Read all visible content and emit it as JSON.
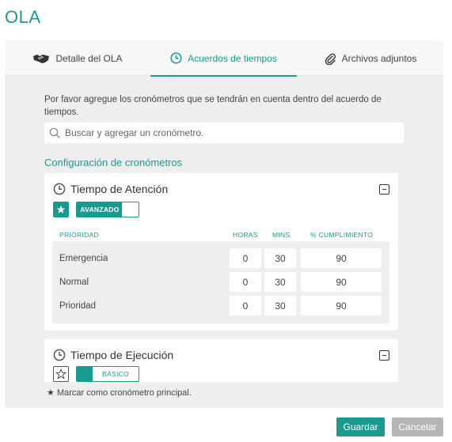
{
  "page": {
    "title": "OLA"
  },
  "tabs": [
    {
      "label": "Detalle del OLA",
      "icon": "handshake-icon",
      "active": false
    },
    {
      "label": "Acuerdos de tiempos",
      "icon": "clock-icon",
      "active": true
    },
    {
      "label": "Archivos adjuntos",
      "icon": "paperclip-icon",
      "active": false
    }
  ],
  "intro": "Por favor agregue los cronómetros que se tendrán en cuenta dentro del acuerdo de tiempos.",
  "search": {
    "placeholder": "Buscar y agregar un cronómetro.",
    "value": "",
    "icon": "search-icon"
  },
  "section_title": "Configuración de cronómetros",
  "timers": [
    {
      "title": "Tiempo de Atención",
      "starred": true,
      "mode_label": "AVANZADO",
      "columns": {
        "priority": "PRIORIDAD",
        "hours": "HORAS",
        "mins": "MINS",
        "compliance": "% CUMPLIMIENTO"
      },
      "rows": [
        {
          "label": "Emergencia",
          "hours": "0",
          "mins": "30",
          "compliance": "90"
        },
        {
          "label": "Normal",
          "hours": "0",
          "mins": "30",
          "compliance": "90"
        },
        {
          "label": "Prioridad",
          "hours": "0",
          "mins": "30",
          "compliance": "90"
        }
      ]
    },
    {
      "title": "Tiempo de Ejecución",
      "starred": false,
      "mode_label": "BÁSICO"
    }
  ],
  "footnote": {
    "star": "★",
    "text": "Marcar como cronómetro principal."
  },
  "actions": {
    "save": "Guardar",
    "cancel": "Cancelar"
  },
  "colors": {
    "accent": "#1a9a8f",
    "panel": "#eeeeee",
    "muted_button": "#b5b5b5"
  }
}
